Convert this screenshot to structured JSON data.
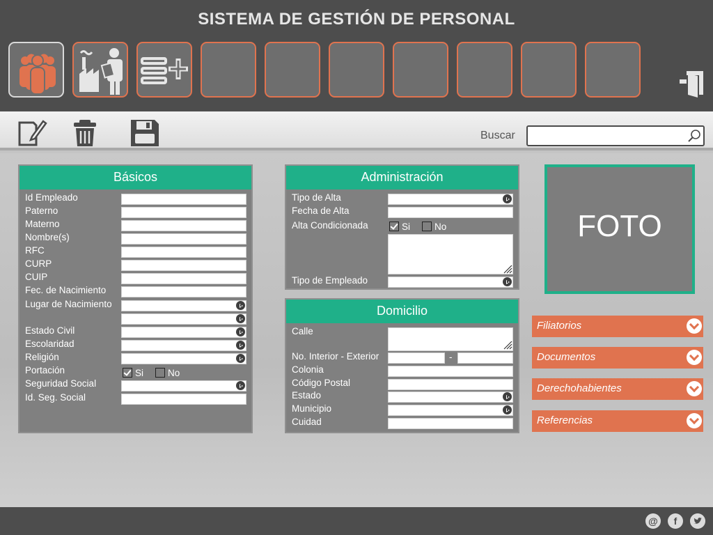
{
  "app": {
    "title": "SISTEMA DE GESTIÓN DE PERSONAL"
  },
  "modules": [
    {
      "name": "personal-icon"
    },
    {
      "name": "empresa-icon"
    },
    {
      "name": "add-list-icon"
    },
    {
      "name": "empty"
    },
    {
      "name": "empty"
    },
    {
      "name": "empty"
    },
    {
      "name": "empty"
    },
    {
      "name": "empty"
    },
    {
      "name": "empty"
    },
    {
      "name": "empty"
    }
  ],
  "toolbar": {
    "icons": [
      "edit-icon",
      "trash-icon",
      "save-icon"
    ]
  },
  "search": {
    "label": "Buscar",
    "placeholder": "",
    "value": ""
  },
  "colors": {
    "header": "#4d4d4d",
    "accent_orange": "#e0734f",
    "accent_green": "#1fb089",
    "panel": "#808080"
  },
  "basicos": {
    "title": "Básicos",
    "fields": {
      "id_empleado": "Id Empleado",
      "paterno": "Paterno",
      "materno": "Materno",
      "nombres": "Nombre(s)",
      "rfc": "RFC",
      "curp": "CURP",
      "cuip": "CUIP",
      "fec_nacimiento": "Fec. de Nacimiento",
      "lugar_nacimiento": "Lugar de Nacimiento",
      "estado_civil": "Estado Civil",
      "escolaridad": "Escolaridad",
      "religion": "Religión",
      "portacion": "Portación",
      "seguridad_social": "Seguridad Social",
      "id_seg_social": "Id. Seg. Social"
    },
    "portacion_si": "Si",
    "portacion_no": "No"
  },
  "administracion": {
    "title": "Administración",
    "tipo_alta": "Tipo de Alta",
    "fecha_alta": "Fecha de Alta",
    "alta_condicionada": "Alta Condicionada",
    "si": "Si",
    "no": "No",
    "tipo_empleado": "Tipo de Empleado"
  },
  "domicilio": {
    "title": "Domicilio",
    "calle": "Calle",
    "no_int_ext": "No. Interior - Exterior",
    "separator": "-",
    "colonia": "Colonia",
    "codigo_postal": "Código Postal",
    "estado": "Estado",
    "municipio": "Municipio",
    "cuidad": "Cuidad"
  },
  "photo": {
    "label": "FOTO"
  },
  "accordions": [
    "Filiatorios",
    "Documentos",
    "Derechohabientes",
    "Referencias"
  ],
  "footer": {
    "email": "@",
    "facebook": "f",
    "twitter": "twitter-icon"
  }
}
